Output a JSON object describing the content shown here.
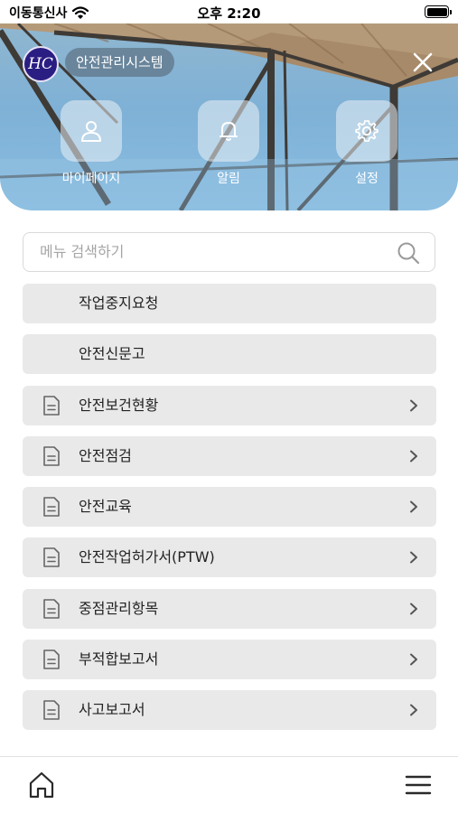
{
  "status_bar": {
    "carrier": "이동통신사",
    "time": "오후 2:20"
  },
  "header": {
    "app_name": "안전관리시스템",
    "logo_text": "HC",
    "actions": [
      {
        "label": "마이페이지",
        "icon": "user-icon"
      },
      {
        "label": "알림",
        "icon": "bell-icon"
      },
      {
        "label": "설정",
        "icon": "gear-icon"
      }
    ]
  },
  "search": {
    "placeholder": "메뉴 검색하기",
    "value": ""
  },
  "menu": {
    "items": [
      {
        "label": "작업중지요청",
        "icon": "",
        "has_chevron": false
      },
      {
        "label": "안전신문고",
        "icon": "",
        "has_chevron": false
      },
      {
        "label": "안전보건현황",
        "icon": "document-icon",
        "has_chevron": true
      },
      {
        "label": "안전점검",
        "icon": "document-icon",
        "has_chevron": true
      },
      {
        "label": "안전교육",
        "icon": "document-icon",
        "has_chevron": true
      },
      {
        "label": "안전작업허가서(PTW)",
        "icon": "document-icon",
        "has_chevron": true
      },
      {
        "label": "중점관리항목",
        "icon": "document-icon",
        "has_chevron": true
      },
      {
        "label": "부적합보고서",
        "icon": "document-icon",
        "has_chevron": true
      },
      {
        "label": "사고보고서",
        "icon": "document-icon",
        "has_chevron": true
      }
    ]
  },
  "bottom_bar": {
    "left_icon": "home-icon",
    "right_icon": "hamburger-menu-icon"
  },
  "colors": {
    "menu_item_bg": "#e9e9e9",
    "logo_bg": "#2a1e83",
    "hero_sky": "#7fb1d6"
  }
}
